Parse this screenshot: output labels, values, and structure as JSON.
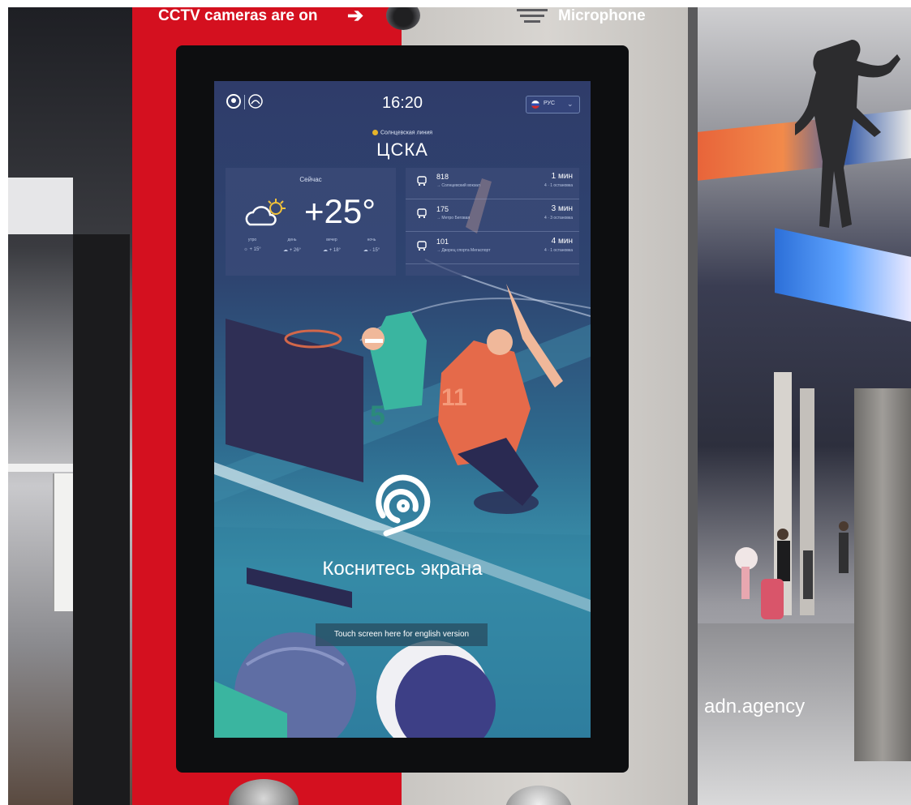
{
  "kiosk": {
    "cctv_label": "CCTV cameras are on",
    "microphone_label": "Microphone",
    "brand_red": "#d4101f"
  },
  "screen": {
    "clock": "16:20",
    "language": {
      "selected": "РУС",
      "flag": "russia-flag-icon"
    },
    "station": {
      "line": "Солнцевская линия",
      "name": "ЦСКА",
      "line_color": "#e5b42a"
    },
    "weather": {
      "now_label": "Сейчас",
      "icon": "partly-cloudy-icon",
      "temperature": "+25°",
      "forecast": [
        {
          "period": "утро",
          "icon": "sun-icon",
          "temp": "+ 15°"
        },
        {
          "period": "день",
          "icon": "cloud-icon",
          "temp": "+ 26°"
        },
        {
          "period": "вечер",
          "icon": "cloud-icon",
          "temp": "+ 18°"
        },
        {
          "period": "ночь",
          "icon": "cloud-icon",
          "temp": "- 15°"
        }
      ]
    },
    "transport": [
      {
        "route": "818",
        "destination": "→ Солнцевский вокзал",
        "time": "1 мин",
        "stops": "4 · 1 остановка"
      },
      {
        "route": "175",
        "destination": "→ Метро Беговая",
        "time": "3 мин",
        "stops": "4 · 3 остановка"
      },
      {
        "route": "101",
        "destination": "→ Дворец спорта Мегаспорт",
        "time": "4 мин",
        "stops": "4 · 1 остановка"
      }
    ],
    "touch_prompt": "Коснитесь экрана",
    "english_button": "Touch screen here for english version"
  },
  "watermark": "adn.agency"
}
